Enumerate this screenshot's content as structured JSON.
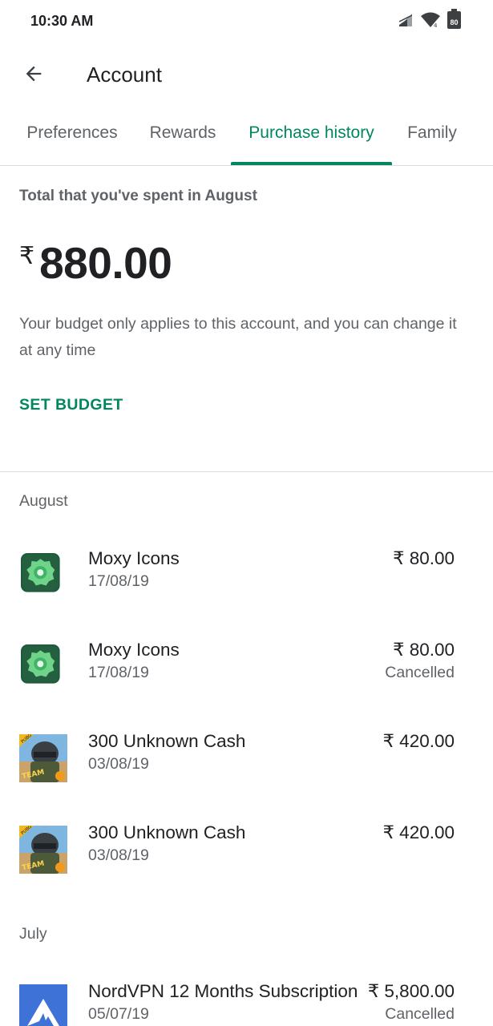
{
  "status_bar": {
    "time": "10:30 AM",
    "battery": "80"
  },
  "app_bar": {
    "title": "Account"
  },
  "tabs": [
    {
      "label": "Preferences"
    },
    {
      "label": "Rewards"
    },
    {
      "label": "Purchase history",
      "active": true
    },
    {
      "label": "Family"
    }
  ],
  "summary": {
    "spent_label": "Total that you've spent in August",
    "currency": "₹",
    "amount": "880.00",
    "budget_note": "Your budget only applies to this account, and you can change it at any time",
    "set_budget_label": "SET BUDGET"
  },
  "months": [
    {
      "label": "August"
    },
    {
      "label": "July"
    }
  ],
  "purchases": [
    {
      "name": "Moxy Icons",
      "date": "17/08/19",
      "price": "₹ 80.00",
      "status": "",
      "icon": "moxy-icons-icon"
    },
    {
      "name": "Moxy Icons",
      "date": "17/08/19",
      "price": "₹ 80.00",
      "status": "Cancelled",
      "icon": "moxy-icons-icon"
    },
    {
      "name": "300 Unknown Cash",
      "date": "03/08/19",
      "price": "₹ 420.00",
      "status": "",
      "icon": "pubg-icon"
    },
    {
      "name": "300 Unknown Cash",
      "date": "03/08/19",
      "price": "₹ 420.00",
      "status": "",
      "icon": "pubg-icon"
    },
    {
      "name": "NordVPN 12 Months Subscription",
      "date": "05/07/19",
      "price": "₹ 5,800.00",
      "status": "Cancelled",
      "icon": "nordvpn-icon"
    }
  ],
  "colors": {
    "accent": "#01875f",
    "text_primary": "#202124",
    "text_secondary": "#5f6368",
    "divider": "#dadce0"
  }
}
